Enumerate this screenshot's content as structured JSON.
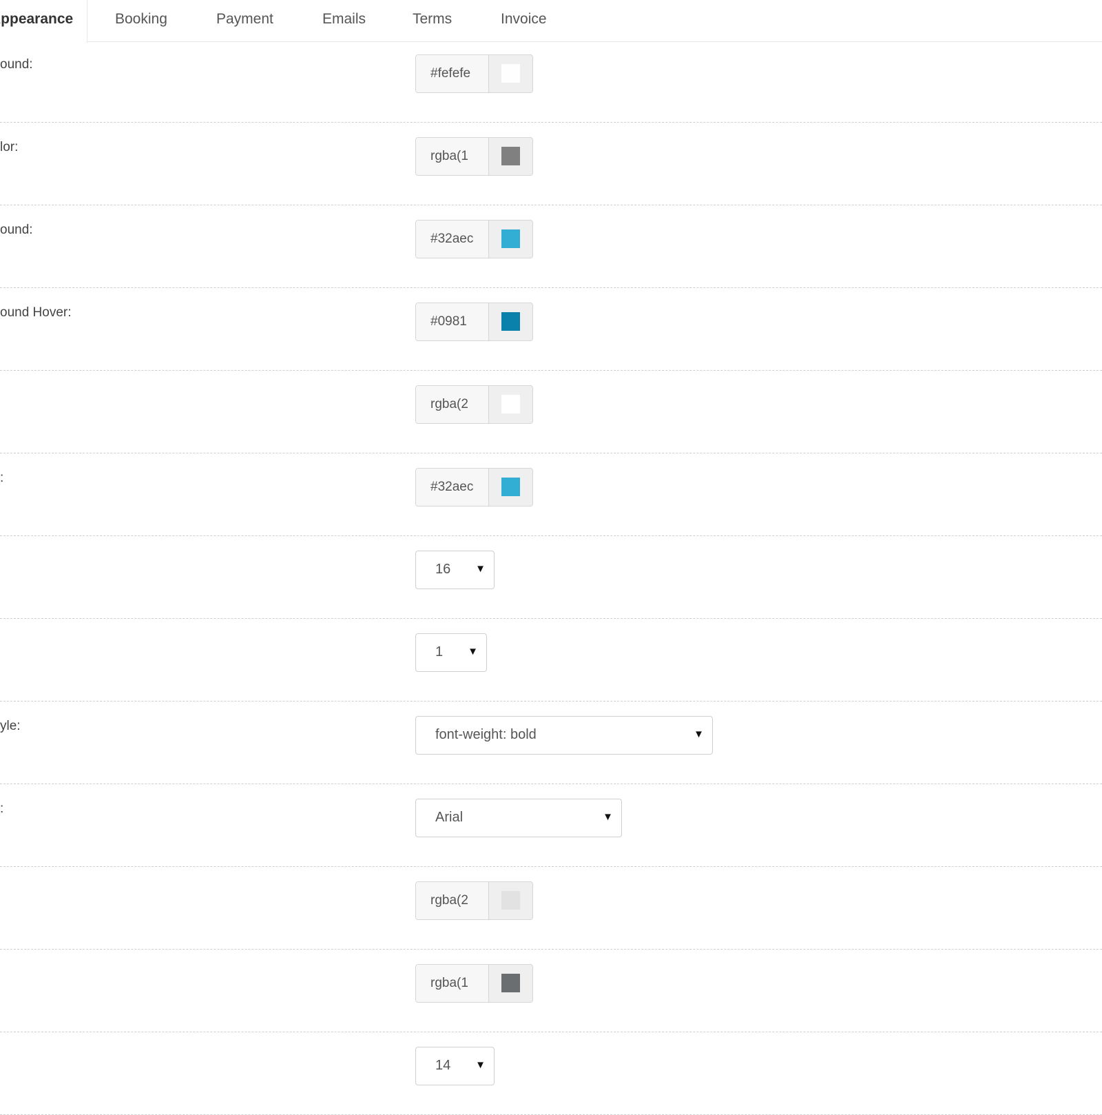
{
  "tabs": [
    {
      "label": "Appearance",
      "active": true
    },
    {
      "label": "Booking"
    },
    {
      "label": "Payment"
    },
    {
      "label": "Emails"
    },
    {
      "label": "Terms"
    },
    {
      "label": "Invoice"
    }
  ],
  "rows": [
    {
      "label": "ound:",
      "control": "color",
      "value": "#fefefe",
      "swatch": "#fefefe"
    },
    {
      "label": "lor:",
      "control": "color",
      "value": "rgba(1",
      "swatch": "#808080"
    },
    {
      "label": "ound:",
      "control": "color",
      "value": "#32aec",
      "swatch": "#32aed4"
    },
    {
      "label": "ound Hover:",
      "control": "color",
      "value": "#0981",
      "swatch": "#0981ab"
    },
    {
      "label": "",
      "control": "color",
      "value": "rgba(2",
      "swatch": "#ffffff"
    },
    {
      "label": ":",
      "control": "color",
      "value": "#32aec",
      "swatch": "#32aed4"
    },
    {
      "label": "",
      "control": "select",
      "value": "16"
    },
    {
      "label": "",
      "control": "select",
      "value": "1"
    },
    {
      "label": "yle:",
      "control": "select",
      "value": "font-weight: bold"
    },
    {
      "label": ":",
      "control": "select",
      "value": "Arial"
    },
    {
      "label": "",
      "control": "color",
      "value": "rgba(2",
      "swatch": "#e2e2e2"
    },
    {
      "label": "",
      "control": "color",
      "value": "rgba(1",
      "swatch": "#6a6e70"
    },
    {
      "label": "",
      "control": "select",
      "value": "14"
    }
  ],
  "icons": {
    "dropdown": "triangle-down-icon"
  },
  "colors": {
    "accent": "#32aed4",
    "accent_hover": "#0981ab",
    "divider": "#cfcfcf"
  }
}
